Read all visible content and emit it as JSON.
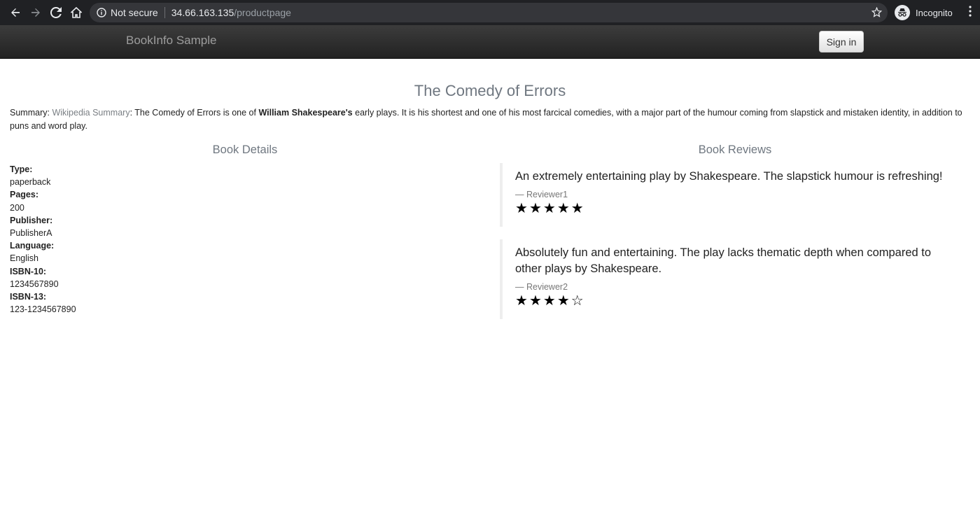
{
  "browser": {
    "secure_label": "Not secure",
    "url_host": "34.66.163.135",
    "url_path": "/productpage",
    "incognito_label": "Incognito"
  },
  "navbar": {
    "brand": "BookInfo Sample",
    "signin_label": "Sign in"
  },
  "product": {
    "title": "The Comedy of Errors",
    "summary_label": "Summary: ",
    "summary_link": "Wikipedia Summary",
    "summary_text_1": ": The Comedy of Errors is one of ",
    "summary_bold": "William Shakespeare's",
    "summary_text_2": " early plays. It is his shortest and one of his most farcical comedies, with a major part of the humour coming from slapstick and mistaken identity, in addition to puns and word play."
  },
  "details": {
    "heading": "Book Details",
    "items": [
      {
        "label": "Type:",
        "value": "paperback"
      },
      {
        "label": "Pages:",
        "value": "200"
      },
      {
        "label": "Publisher:",
        "value": "PublisherA"
      },
      {
        "label": "Language:",
        "value": "English"
      },
      {
        "label": "ISBN-10:",
        "value": "1234567890"
      },
      {
        "label": "ISBN-13:",
        "value": "123-1234567890"
      }
    ]
  },
  "reviews": {
    "heading": "Book Reviews",
    "items": [
      {
        "text": "An extremely entertaining play by Shakespeare. The slapstick humour is refreshing!",
        "reviewer": "— Reviewer1",
        "rating": 5,
        "rating_max": 5
      },
      {
        "text": "Absolutely fun and entertaining. The play lacks thematic depth when compared to other plays by Shakespeare.",
        "reviewer": "— Reviewer2",
        "rating": 4,
        "rating_max": 5
      }
    ]
  }
}
